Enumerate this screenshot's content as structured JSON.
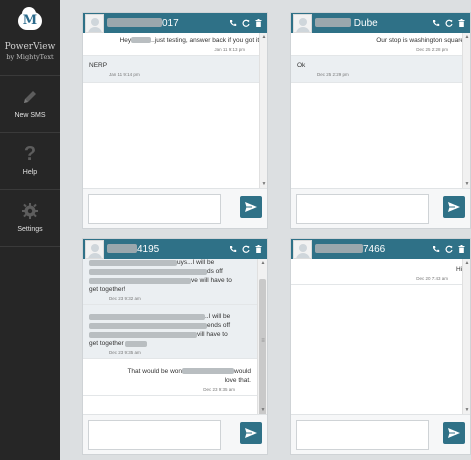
{
  "app": {
    "brand_line1": "PowerView",
    "brand_line2": "by MightyText",
    "accent": "#2f7187"
  },
  "sidebar": {
    "items": [
      {
        "label": "New SMS",
        "icon": "pencil-icon"
      },
      {
        "label": "Help",
        "icon": "question-icon"
      },
      {
        "label": "Settings",
        "icon": "gear-icon"
      }
    ]
  },
  "threads": [
    {
      "contact_suffix": "017",
      "messages": [
        {
          "dir": "out",
          "text_pre": "Hey",
          "text_post": "..just testing, answer back if you got it!",
          "time": "Jan 11 9:13 pm"
        },
        {
          "dir": "in",
          "text": "NERP",
          "time": "Jan 11 9:14 pm"
        }
      ],
      "input_value": ""
    },
    {
      "contact_suffix": "Dube",
      "messages": [
        {
          "dir": "out",
          "text": "Our stop is washington square",
          "time": "Dec 25 2:28 pm"
        },
        {
          "dir": "in",
          "text": "Ok",
          "time": "Dec 25 2:29 pm"
        }
      ],
      "input_value": ""
    },
    {
      "contact_suffix": "4195",
      "messages": [
        {
          "dir": "in",
          "frag1": "uys...I will be",
          "frag2": "ds off",
          "frag3": "ve will have to",
          "text_end": "get together!",
          "time": "Dec 23 9:32 am"
        },
        {
          "dir": "in",
          "frag1": "..I will be",
          "frag2": "ends off",
          "frag3": "vill have to",
          "text_end": "get together",
          "time": "Dec 23 9:35 am"
        },
        {
          "dir": "out",
          "text_pre": "That would be won",
          "text_post": "would",
          "text_line2": "love that.",
          "time": "Dec 23 9:35 am"
        }
      ],
      "input_value": ""
    },
    {
      "contact_suffix": "7466",
      "messages": [
        {
          "dir": "out",
          "text": "Hi!",
          "time": "Dec 20 7:43 am"
        }
      ],
      "input_value": ""
    }
  ]
}
